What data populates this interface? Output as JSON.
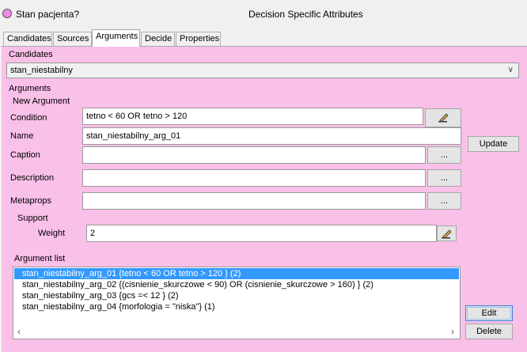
{
  "titlebar": {
    "left_title": "Stan pacjenta?",
    "center_title": "Decision Specific Attributes",
    "icon_color": "#ee8ee6"
  },
  "tabs": [
    "Candidates",
    "Sources",
    "Arguments",
    "Decide",
    "Properties"
  ],
  "active_tab": "Arguments",
  "panel_color": "#f9c0e8",
  "candidates": {
    "label": "Candidates",
    "selected": "stan_niestabilny"
  },
  "arguments": {
    "label": "Arguments",
    "new_argument_label": "New Argument",
    "condition_label": "Condition",
    "condition_value": "tetno  < 60  OR tetno > 120",
    "name_label": "Name",
    "name_value": "stan_niestabilny_arg_01",
    "caption_label": "Caption",
    "caption_value": "",
    "description_label": "Description",
    "description_value": "",
    "metaprops_label": "Metaprops",
    "metaprops_value": "",
    "ellipsis": "...",
    "update_label": "Update"
  },
  "support": {
    "label": "Support",
    "weight_label": "Weight",
    "weight_value": "2"
  },
  "argument_list": {
    "label": "Argument list",
    "items": [
      "stan_niestabilny_arg_01  {tetno  < 60  OR tetno > 120 } (2)",
      "stan_niestabilny_arg_02  {(cisnienie_skurczowe  < 90) OR (cisnienie_skurczowe > 160) } (2)",
      "stan_niestabilny_arg_03  {gcs  =< 12 } (2)",
      "stan_niestabilny_arg_04  {morfologia  = \"niska\"} (1)"
    ],
    "selected_index": 0,
    "edit_label": "Edit",
    "delete_label": "Delete",
    "selection_color": "#3399ff"
  }
}
